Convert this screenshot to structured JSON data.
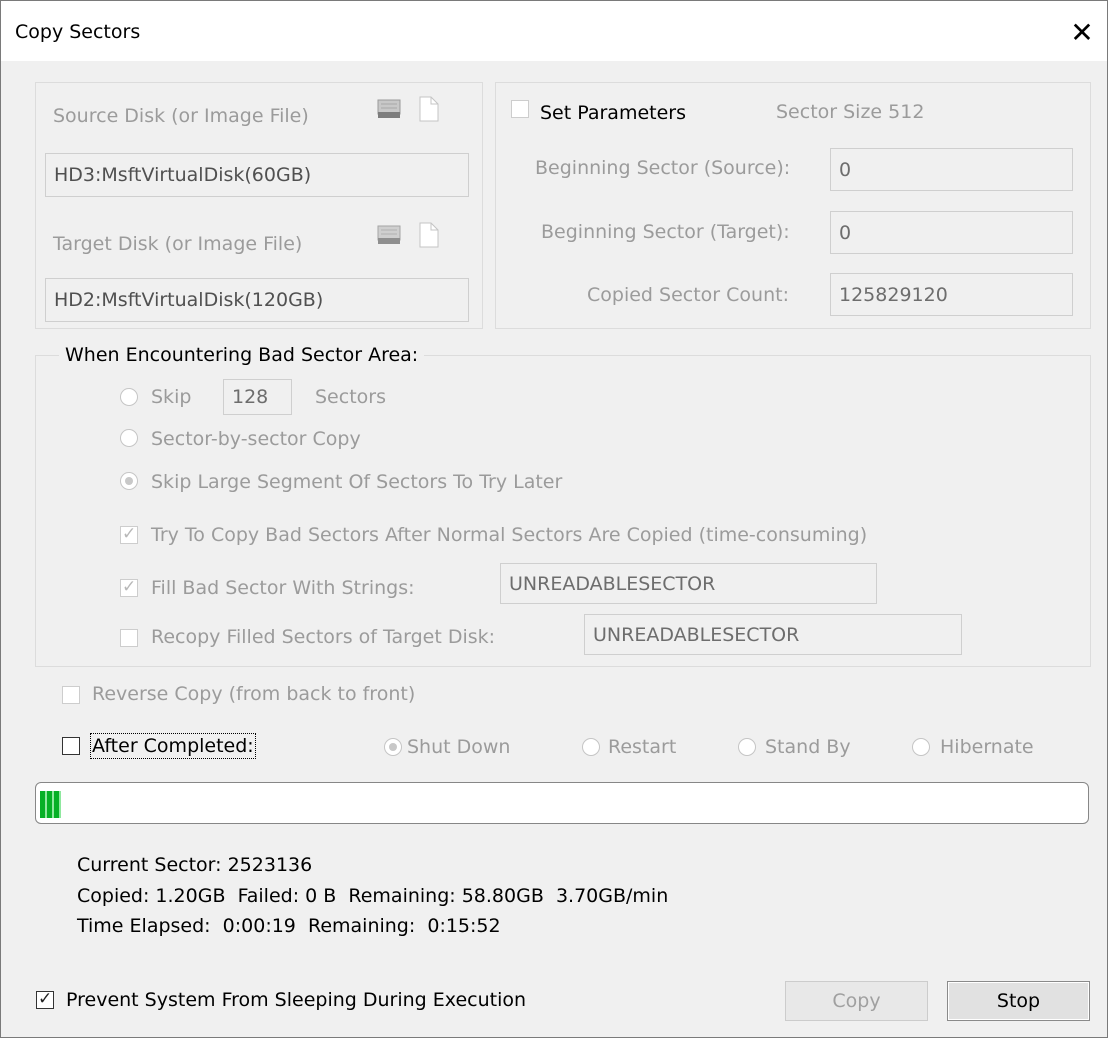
{
  "window": {
    "title": "Copy Sectors",
    "close_glyph": "✕"
  },
  "source": {
    "label": "Source Disk (or Image File)",
    "value": "HD3:MsftVirtualDisk(60GB)"
  },
  "target": {
    "label": "Target Disk (or Image File)",
    "value": "HD2:MsftVirtualDisk(120GB)"
  },
  "parameters": {
    "set_label": "Set Parameters",
    "sector_size": "Sector Size 512",
    "begin_source_label": "Beginning Sector (Source):",
    "begin_source_value": "0",
    "begin_target_label": "Beginning Sector (Target):",
    "begin_target_value": "0",
    "count_label": "Copied Sector Count:",
    "count_value": "125829120"
  },
  "bad_sector": {
    "group_label": "When Encountering Bad Sector Area:",
    "skip_label": "Skip",
    "skip_value": "128",
    "skip_unit": "Sectors",
    "sector_by_sector_label": "Sector-by-sector Copy",
    "skip_large_label": "Skip Large Segment Of Sectors To Try Later",
    "try_copy_label": "Try To Copy Bad Sectors After Normal Sectors Are Copied (time-consuming)",
    "fill_label": "Fill Bad Sector With Strings:",
    "fill_value": "UNREADABLESECTOR",
    "recopy_label": "Recopy Filled Sectors of Target Disk:",
    "recopy_value": "UNREADABLESECTOR"
  },
  "reverse_copy_label": "Reverse Copy (from back to front)",
  "after_completed": {
    "label": "After Completed:",
    "options": [
      "Shut Down",
      "Restart",
      "Stand By",
      "Hibernate"
    ],
    "selected": "Shut Down"
  },
  "progress": {
    "fraction": 0.02
  },
  "status": {
    "current_sector": "Current Sector: 2523136",
    "copied_line": "Copied: 1.20GB  Failed: 0 B  Remaining: 58.80GB  3.70GB/min",
    "time_line": "Time Elapsed:  0:00:19  Remaining:  0:15:52"
  },
  "prevent_sleep_label": "Prevent System From Sleeping During Execution",
  "buttons": {
    "copy": "Copy",
    "stop": "Stop"
  },
  "colors": {
    "progress_green": "#06b025",
    "dialog_bg": "#f0f0f0"
  },
  "icons": {
    "disk": "hard-disk-icon",
    "file": "file-icon",
    "close": "close-icon"
  }
}
